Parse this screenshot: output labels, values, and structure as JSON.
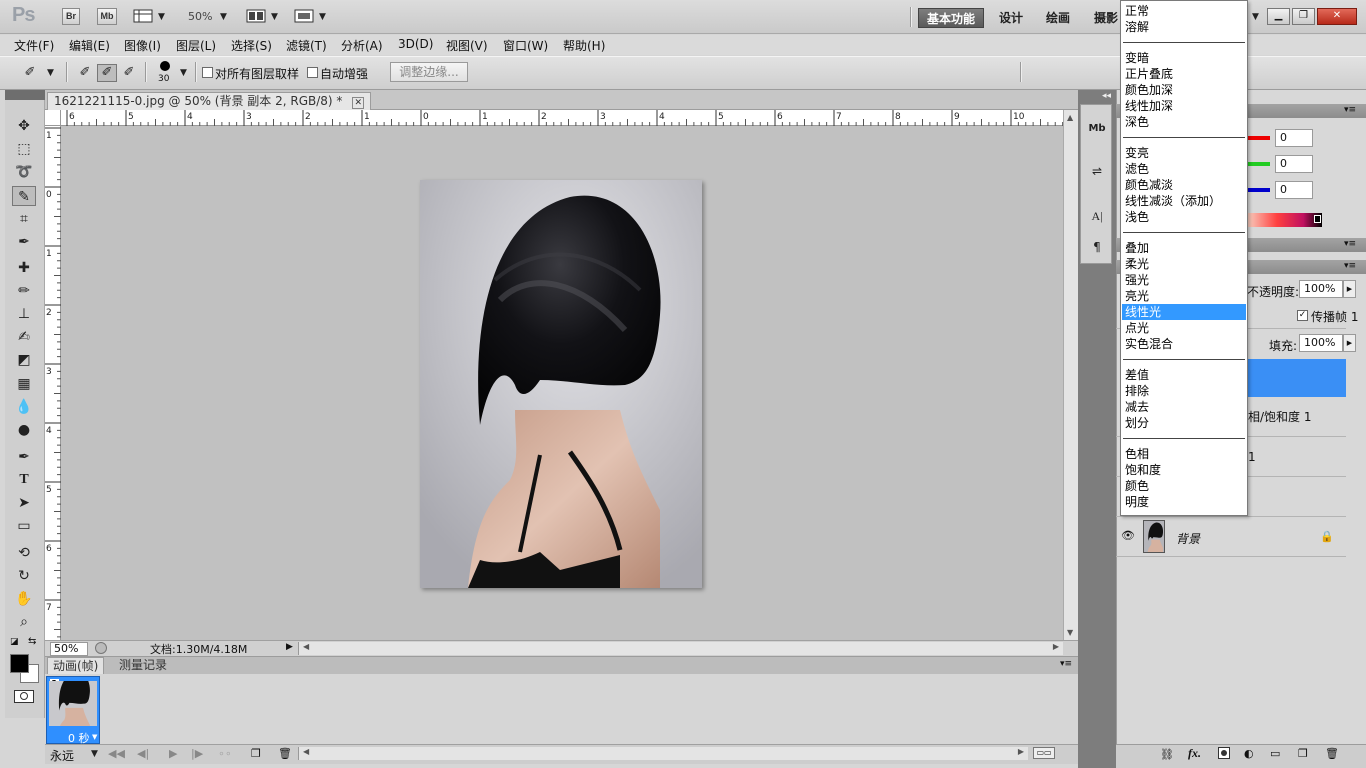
{
  "app": {
    "logo": "Ps",
    "bridge_btn": "Br",
    "minibridge_btn": "Mb",
    "zoom": "50%",
    "workspaces": [
      "基本功能",
      "设计",
      "绘画",
      "摄影"
    ]
  },
  "menu": [
    "文件(F)",
    "编辑(E)",
    "图像(I)",
    "图层(L)",
    "选择(S)",
    "滤镜(T)",
    "分析(A)",
    "3D(D)",
    "视图(V)",
    "窗口(W)",
    "帮助(H)"
  ],
  "options": {
    "brush_size": "30",
    "sample_all_layers": "对所有图层取样",
    "auto_enhance": "自动增强",
    "refine_edge": "调整边缘..."
  },
  "document": {
    "tab_title": "1621221115-0.jpg @ 50% (背景 副本 2, RGB/8) *",
    "ruler_h": [
      "6",
      "5",
      "4",
      "3",
      "2",
      "1",
      "0",
      "1",
      "2",
      "3",
      "4",
      "5",
      "6",
      "7",
      "8",
      "9",
      "10"
    ],
    "ruler_v": [
      "1",
      "0",
      "1",
      "2",
      "3",
      "4",
      "5",
      "6",
      "7"
    ],
    "zoom_field": "50%",
    "doc_info": "文档:1.30M/4.18M"
  },
  "anim": {
    "tabs": [
      "动画(帧)",
      "测量记录"
    ],
    "frame_number": "1",
    "frame_delay": "0 秒",
    "loop": "永远"
  },
  "color_panel": {
    "r": "0",
    "g": "0",
    "b": "0"
  },
  "layers": {
    "opacity_label": "不透明度:",
    "opacity": "100%",
    "propagate_label": "传播帧 1",
    "fill_label": "填充:",
    "fill": "100%",
    "hue_layer_label": "相/饱和度 1",
    "layer3_suffix": "1",
    "background_layer": "背景"
  },
  "blend_modes": {
    "groups": [
      [
        "正常",
        "溶解"
      ],
      [
        "变暗",
        "正片叠底",
        "颜色加深",
        "线性加深",
        "深色"
      ],
      [
        "变亮",
        "滤色",
        "颜色减淡",
        "线性减淡（添加）",
        "浅色"
      ],
      [
        "叠加",
        "柔光",
        "强光",
        "亮光",
        "线性光",
        "点光",
        "实色混合"
      ],
      [
        "差值",
        "排除",
        "减去",
        "划分"
      ],
      [
        "色相",
        "饱和度",
        "颜色",
        "明度"
      ]
    ],
    "selected": "线性光"
  },
  "colors": {
    "accent": "#3399ff",
    "workspace_active": "#5a5a5a",
    "close": "#c0392b",
    "canvas_bg": "#c1c1c1"
  }
}
